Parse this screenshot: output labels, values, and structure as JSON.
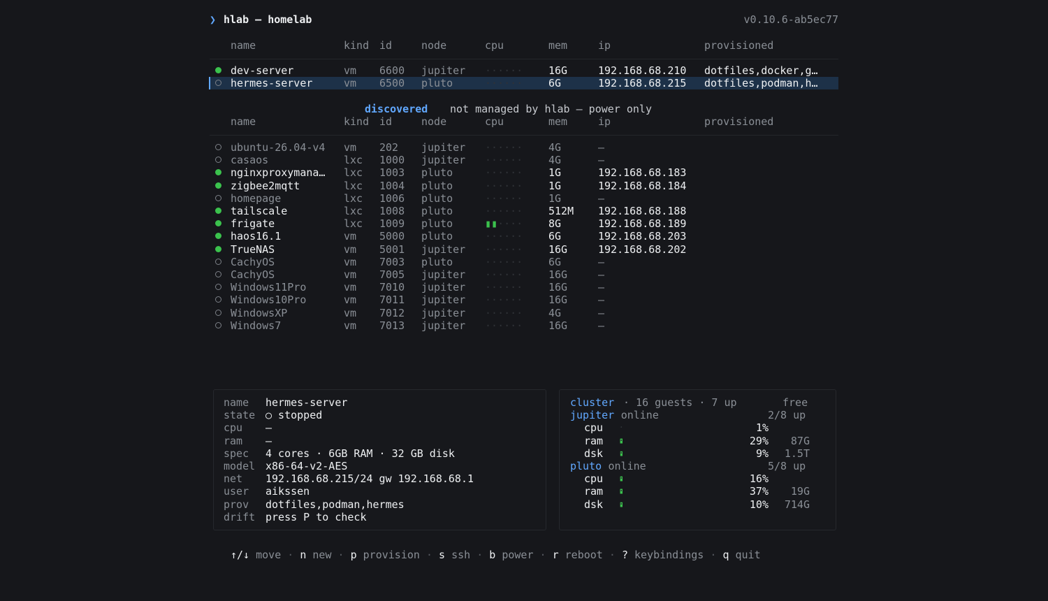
{
  "header": {
    "prompt_symbol": "❯",
    "title": "hlab — homelab",
    "version": "v0.10.6-ab5ec77"
  },
  "columns": {
    "name": "name",
    "kind": "kind",
    "id": "id",
    "node": "node",
    "cpu": "cpu",
    "mem": "mem",
    "ip": "ip",
    "provisioned": "provisioned"
  },
  "managed": [
    {
      "status": "up",
      "name": "dev-server",
      "kind": "vm",
      "id": "6600",
      "node": "jupiter",
      "cpu_level": 0,
      "mem": "16G",
      "ip": "192.168.68.210",
      "provisioned": "dotfiles,docker,g…"
    },
    {
      "status": "down",
      "name": "hermes-server",
      "kind": "vm",
      "id": "6500",
      "node": "pluto",
      "cpu_level": 0,
      "mem": "6G",
      "ip": "192.168.68.215",
      "provisioned": "dotfiles,podman,h…",
      "selected": true
    }
  ],
  "discovered": {
    "label": "discovered",
    "description": "not managed by hlab — power only",
    "rows": [
      {
        "status": "down",
        "name": "ubuntu-26.04-v4",
        "kind": "vm",
        "id": "202",
        "node": "jupiter",
        "cpu_level": 0,
        "mem": "4G",
        "ip": "—"
      },
      {
        "status": "down",
        "name": "casaos",
        "kind": "lxc",
        "id": "1000",
        "node": "jupiter",
        "cpu_level": 0,
        "mem": "4G",
        "ip": "—"
      },
      {
        "status": "up",
        "name": "nginxproxymana…",
        "kind": "lxc",
        "id": "1003",
        "node": "pluto",
        "cpu_level": 0,
        "mem": "1G",
        "ip": "192.168.68.183"
      },
      {
        "status": "up",
        "name": "zigbee2mqtt",
        "kind": "lxc",
        "id": "1004",
        "node": "pluto",
        "cpu_level": 0,
        "mem": "1G",
        "ip": "192.168.68.184"
      },
      {
        "status": "down",
        "name": "homepage",
        "kind": "lxc",
        "id": "1006",
        "node": "pluto",
        "cpu_level": 0,
        "mem": "1G",
        "ip": "—"
      },
      {
        "status": "up",
        "name": "tailscale",
        "kind": "lxc",
        "id": "1008",
        "node": "pluto",
        "cpu_level": 0,
        "mem": "512M",
        "ip": "192.168.68.188"
      },
      {
        "status": "up",
        "name": "frigate",
        "kind": "lxc",
        "id": "1009",
        "node": "pluto",
        "cpu_level": 2,
        "mem": "8G",
        "ip": "192.168.68.189"
      },
      {
        "status": "up",
        "name": "haos16.1",
        "kind": "vm",
        "id": "5000",
        "node": "pluto",
        "cpu_level": 0,
        "mem": "6G",
        "ip": "192.168.68.203"
      },
      {
        "status": "up",
        "name": "TrueNAS",
        "kind": "vm",
        "id": "5001",
        "node": "jupiter",
        "cpu_level": 0,
        "mem": "16G",
        "ip": "192.168.68.202"
      },
      {
        "status": "down",
        "name": "CachyOS",
        "kind": "vm",
        "id": "7003",
        "node": "pluto",
        "cpu_level": 0,
        "mem": "6G",
        "ip": "—"
      },
      {
        "status": "down",
        "name": "CachyOS",
        "kind": "vm",
        "id": "7005",
        "node": "jupiter",
        "cpu_level": 0,
        "mem": "16G",
        "ip": "—"
      },
      {
        "status": "down",
        "name": "Windows11Pro",
        "kind": "vm",
        "id": "7010",
        "node": "jupiter",
        "cpu_level": 0,
        "mem": "16G",
        "ip": "—"
      },
      {
        "status": "down",
        "name": "Windows10Pro",
        "kind": "vm",
        "id": "7011",
        "node": "jupiter",
        "cpu_level": 0,
        "mem": "16G",
        "ip": "—"
      },
      {
        "status": "down",
        "name": "WindowsXP",
        "kind": "vm",
        "id": "7012",
        "node": "jupiter",
        "cpu_level": 0,
        "mem": "4G",
        "ip": "—"
      },
      {
        "status": "down",
        "name": "Windows7",
        "kind": "vm",
        "id": "7013",
        "node": "jupiter",
        "cpu_level": 0,
        "mem": "16G",
        "ip": "—"
      }
    ]
  },
  "detail": {
    "fields": [
      {
        "key": "name",
        "value": "hermes-server"
      },
      {
        "key": "state",
        "value": "○ stopped"
      },
      {
        "key": "cpu",
        "value": "—"
      },
      {
        "key": "ram",
        "value": "—"
      },
      {
        "key": "spec",
        "value": "4 cores · 6GB RAM · 32 GB disk"
      },
      {
        "key": "model",
        "value": "x86-64-v2-AES"
      },
      {
        "key": "net",
        "value": "192.168.68.215/24 gw 192.168.68.1"
      },
      {
        "key": "user",
        "value": "aikssen"
      },
      {
        "key": "prov",
        "value": "dotfiles,podman,hermes"
      },
      {
        "key": "drift",
        "value": "press P to check"
      }
    ]
  },
  "cluster": {
    "label": "cluster",
    "guests": "· 16 guests · 7 up",
    "free_label": "free",
    "nodes": [
      {
        "name": "jupiter",
        "state": "online",
        "up": "2/8 up",
        "metrics": [
          {
            "name": "cpu",
            "fraction": 0.01,
            "pct": "1%",
            "free": ""
          },
          {
            "name": "ram",
            "fraction": 0.29,
            "pct": "29%",
            "free": "87G"
          },
          {
            "name": "dsk",
            "fraction": 0.09,
            "pct": "9%",
            "free": "1.5T"
          }
        ]
      },
      {
        "name": "pluto",
        "state": "online",
        "up": "5/8 up",
        "metrics": [
          {
            "name": "cpu",
            "fraction": 0.16,
            "pct": "16%",
            "free": ""
          },
          {
            "name": "ram",
            "fraction": 0.37,
            "pct": "37%",
            "free": "19G"
          },
          {
            "name": "dsk",
            "fraction": 0.1,
            "pct": "10%",
            "free": "714G"
          }
        ]
      }
    ]
  },
  "footer": [
    {
      "key": "↑/↓",
      "desc": "move"
    },
    {
      "key": "n",
      "desc": "new"
    },
    {
      "key": "p",
      "desc": "provision"
    },
    {
      "key": "s",
      "desc": "ssh"
    },
    {
      "key": "b",
      "desc": "power"
    },
    {
      "key": "r",
      "desc": "reboot"
    },
    {
      "key": "?",
      "desc": "keybindings"
    },
    {
      "key": "q",
      "desc": "quit"
    }
  ],
  "colors": {
    "accent": "#61a8ff",
    "up": "#3bc24d",
    "selected_bg": "#1d3148",
    "background": "#16171b"
  }
}
